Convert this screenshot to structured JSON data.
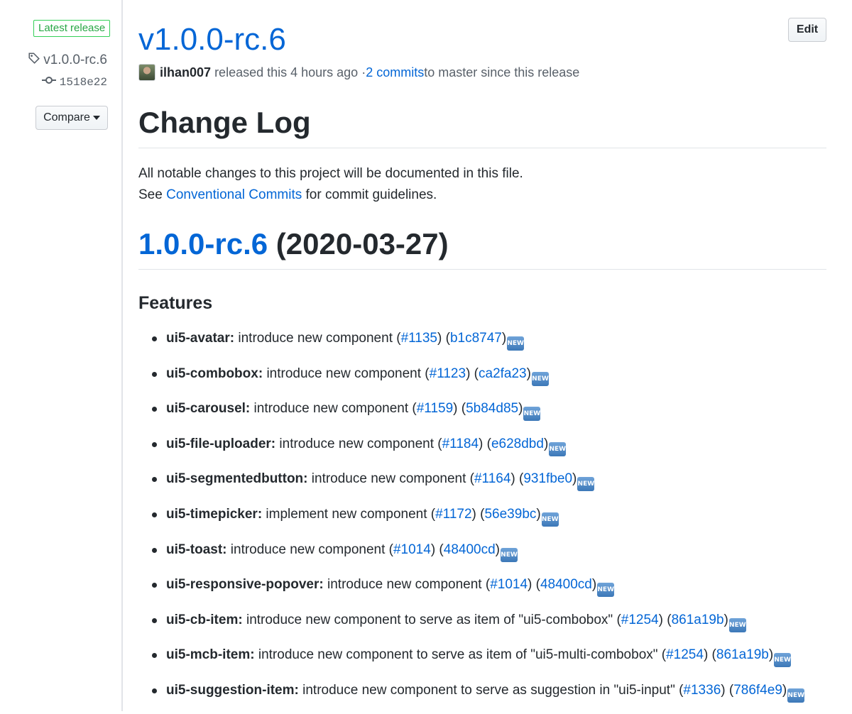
{
  "sidebar": {
    "badge": "Latest release",
    "tag": "v1.0.0-rc.6",
    "commit": "1518e22",
    "compare_label": "Compare"
  },
  "release": {
    "title": "v1.0.0-rc.6",
    "edit_label": "Edit",
    "author": "ilhan007",
    "released_text": "released this 4 hours ago · ",
    "commits_link": "2 commits",
    "commits_suffix": " to master since this release"
  },
  "body": {
    "changelog_title": "Change Log",
    "intro_line1": "All notable changes to this project will be documented in this file.",
    "intro_see": "See ",
    "intro_link": "Conventional Commits",
    "intro_suffix": " for commit guidelines.",
    "version_link": "1.0.0-rc.6",
    "version_date": " (2020-03-27)",
    "features_title": "Features"
  },
  "features": [
    {
      "scope": "ui5-avatar:",
      "desc": " introduce new component (",
      "issue": "#1135",
      "mid": ") (",
      "hash": "b1c8747",
      "end": ")",
      "emoji": "NEW"
    },
    {
      "scope": "ui5-combobox:",
      "desc": " introduce new component (",
      "issue": "#1123",
      "mid": ") (",
      "hash": "ca2fa23",
      "end": ")",
      "emoji": "NEW"
    },
    {
      "scope": "ui5-carousel:",
      "desc": " introduce new component (",
      "issue": "#1159",
      "mid": ") (",
      "hash": "5b84d85",
      "end": ")",
      "emoji": "NEW"
    },
    {
      "scope": "ui5-file-uploader:",
      "desc": " introduce new component (",
      "issue": "#1184",
      "mid": ") (",
      "hash": "e628dbd",
      "end": ")",
      "emoji": "NEW"
    },
    {
      "scope": "ui5-segmentedbutton:",
      "desc": " introduce new component (",
      "issue": "#1164",
      "mid": ") (",
      "hash": "931fbe0",
      "end": ")",
      "emoji": "NEW"
    },
    {
      "scope": "ui5-timepicker:",
      "desc": " implement new component (",
      "issue": "#1172",
      "mid": ") (",
      "hash": "56e39bc",
      "end": ")",
      "emoji": "NEW"
    },
    {
      "scope": "ui5-toast:",
      "desc": " introduce new component (",
      "issue": "#1014",
      "mid": ") (",
      "hash": "48400cd",
      "end": ")",
      "emoji": "NEW"
    },
    {
      "scope": "ui5-responsive-popover:",
      "desc": " introduce new component (",
      "issue": "#1014",
      "mid": ") (",
      "hash": "48400cd",
      "end": ")",
      "emoji": "NEW"
    },
    {
      "scope": "ui5-cb-item:",
      "desc": " introduce new component to serve as item of \"ui5-combobox\" (",
      "issue": "#1254",
      "mid": ") (",
      "hash": "861a19b",
      "end": ")",
      "emoji": "NEW"
    },
    {
      "scope": "ui5-mcb-item:",
      "desc": " introduce new component to serve as item of \"ui5-multi-combobox\" (",
      "issue": "#1254",
      "mid": ") (",
      "hash": "861a19b",
      "end": ")",
      "emoji": "NEW"
    },
    {
      "scope": "ui5-suggestion-item:",
      "desc": " introduce new component to serve as suggestion in \"ui5-input\" (",
      "issue": "#1336",
      "mid": ") (",
      "hash": "786f4e9",
      "end": ")",
      "emoji": "NEW"
    }
  ]
}
